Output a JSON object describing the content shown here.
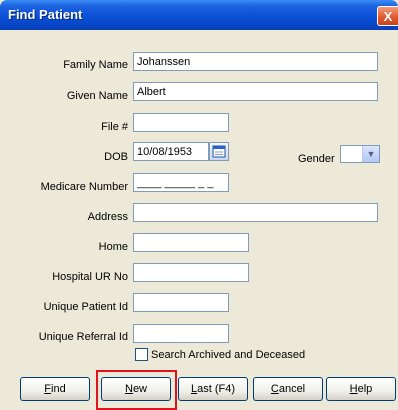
{
  "window": {
    "title": "Find Patient",
    "close_glyph": "X"
  },
  "form": {
    "family_name": {
      "label": "Family Name",
      "value": "Johanssen"
    },
    "given_name": {
      "label": "Given Name",
      "value": "Albert"
    },
    "file_no": {
      "label": "File #",
      "value": ""
    },
    "dob": {
      "label": "DOB",
      "value": "10/08/1953"
    },
    "gender": {
      "label": "Gender",
      "value": ""
    },
    "medicare": {
      "label": "Medicare Number",
      "value": "____ _____ _ _"
    },
    "address": {
      "label": "Address",
      "value": ""
    },
    "home": {
      "label": "Home",
      "value": ""
    },
    "hospital_ur": {
      "label": "Hospital UR No",
      "value": ""
    },
    "unique_patient_id": {
      "label": "Unique Patient Id",
      "value": ""
    },
    "unique_referral_id": {
      "label": "Unique Referral Id",
      "value": ""
    },
    "search_archived": {
      "label": "Search Archived and Deceased",
      "checked": false
    }
  },
  "buttons": {
    "find": {
      "key": "F",
      "rest": "ind"
    },
    "new": {
      "key": "N",
      "rest": "ew"
    },
    "last": {
      "key": "L",
      "rest": "ast (F4)"
    },
    "cancel": {
      "key": "C",
      "rest": "ancel"
    },
    "help": {
      "key": "H",
      "rest": "elp"
    }
  },
  "icons": {
    "calendar": "calendar-icon",
    "dropdown": "chevron-down-icon",
    "close": "close-icon"
  },
  "colors": {
    "titlebar": "#0a4fd8",
    "dialog_bg": "#ece9d8",
    "field_border": "#7f9db9",
    "highlight": "#e0141e"
  }
}
